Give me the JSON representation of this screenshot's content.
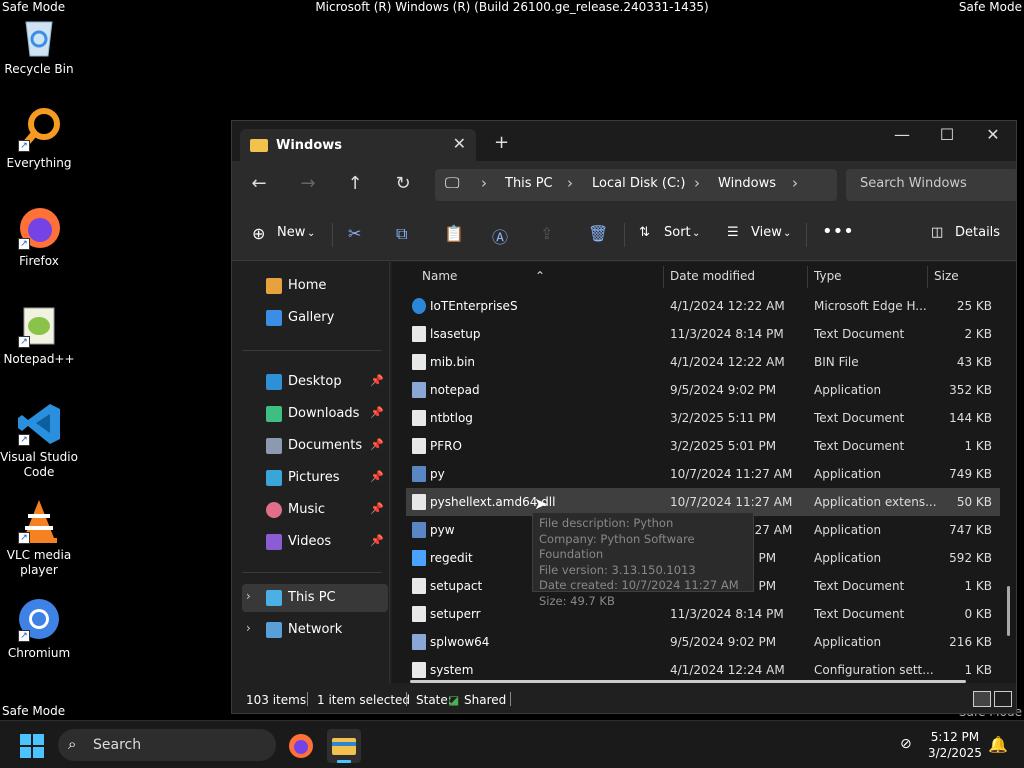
{
  "screen": {
    "safe_mode_label": "Safe Mode",
    "os_title": "Microsoft (R) Windows (R) (Build 26100.ge_release.240331-1435)"
  },
  "desktop_icons": [
    {
      "label": "Recycle Bin"
    },
    {
      "label": "Everything"
    },
    {
      "label": "Firefox"
    },
    {
      "label": "Notepad++"
    },
    {
      "label": "Visual Studio Code"
    },
    {
      "label": "VLC media player"
    },
    {
      "label": "Chromium"
    }
  ],
  "window": {
    "tab_title": "Windows",
    "breadcrumb": [
      "This PC",
      "Local Disk (C:)",
      "Windows"
    ],
    "search_placeholder": "Search Windows",
    "toolbar": {
      "new": "New",
      "sort": "Sort",
      "view": "View",
      "details": "Details"
    }
  },
  "sidebar": {
    "top": [
      {
        "label": "Home",
        "color": "#e6a23c"
      },
      {
        "label": "Gallery",
        "color": "#3a8ee6"
      }
    ],
    "pinned": [
      {
        "label": "Desktop",
        "color": "#2f8fd8"
      },
      {
        "label": "Downloads",
        "color": "#3fbf7f"
      },
      {
        "label": "Documents",
        "color": "#8a9bb0"
      },
      {
        "label": "Pictures",
        "color": "#3aa6d8"
      },
      {
        "label": "Music",
        "color": "#e0708a"
      },
      {
        "label": "Videos",
        "color": "#8a5cd6"
      }
    ],
    "tree": [
      {
        "label": "This PC"
      },
      {
        "label": "Network"
      }
    ]
  },
  "columns": {
    "name": "Name",
    "date": "Date modified",
    "type": "Type",
    "size": "Size"
  },
  "files": [
    {
      "name": "IoTEnterpriseS",
      "date": "4/1/2024 12:22 AM",
      "type": "Microsoft Edge H...",
      "size": "25 KB",
      "icon": "edge"
    },
    {
      "name": "lsasetup",
      "date": "11/3/2024 8:14 PM",
      "type": "Text Document",
      "size": "2 KB",
      "icon": "doc"
    },
    {
      "name": "mib.bin",
      "date": "4/1/2024 12:22 AM",
      "type": "BIN File",
      "size": "43 KB",
      "icon": "doc"
    },
    {
      "name": "notepad",
      "date": "9/5/2024 9:02 PM",
      "type": "Application",
      "size": "352 KB",
      "icon": "app"
    },
    {
      "name": "ntbtlog",
      "date": "3/2/2025 5:11 PM",
      "type": "Text Document",
      "size": "144 KB",
      "icon": "doc"
    },
    {
      "name": "PFRO",
      "date": "3/2/2025 5:01 PM",
      "type": "Text Document",
      "size": "1 KB",
      "icon": "doc"
    },
    {
      "name": "py",
      "date": "10/7/2024 11:27 AM",
      "type": "Application",
      "size": "749 KB",
      "icon": "py"
    },
    {
      "name": "pyshellext.amd64.dll",
      "date": "10/7/2024 11:27 AM",
      "type": "Application extens...",
      "size": "50 KB",
      "icon": "doc"
    },
    {
      "name": "pyw",
      "date": "10/7/2024 11:27 AM",
      "type": "Application",
      "size": "747 KB",
      "icon": "py"
    },
    {
      "name": "regedit",
      "date": "9/5/2024 9:02 PM",
      "type": "Application",
      "size": "592 KB",
      "icon": "reg"
    },
    {
      "name": "setupact",
      "date": "3/2/2025 2:44 PM",
      "type": "Text Document",
      "size": "1 KB",
      "icon": "doc"
    },
    {
      "name": "setuperr",
      "date": "11/3/2024 8:14 PM",
      "type": "Text Document",
      "size": "0 KB",
      "icon": "doc"
    },
    {
      "name": "splwow64",
      "date": "9/5/2024 9:02 PM",
      "type": "Application",
      "size": "216 KB",
      "icon": "app"
    },
    {
      "name": "system",
      "date": "4/1/2024 12:24 AM",
      "type": "Configuration sett...",
      "size": "1 KB",
      "icon": "doc"
    }
  ],
  "tooltip": {
    "lines": [
      "File description: Python",
      "Company: Python Software Foundation",
      "File version: 3.13.150.1013",
      "Date created: 10/7/2024 11:27 AM",
      "Size: 49.7 KB"
    ]
  },
  "status": {
    "items": "103 items",
    "selected": "1 item selected",
    "state_label": "State:",
    "state_value": "Shared"
  },
  "taskbar": {
    "search": "Search",
    "time": "5:12 PM",
    "date": "3/2/2025"
  }
}
